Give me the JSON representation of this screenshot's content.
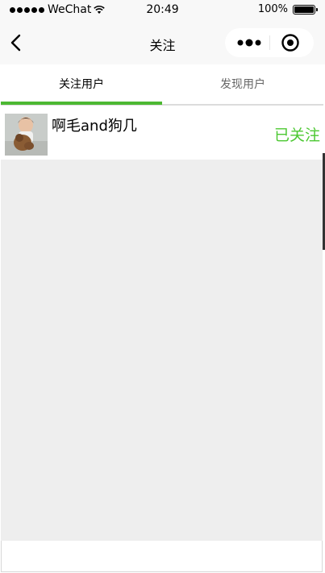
{
  "status_bar": {
    "carrier": "WeChat",
    "time": "20:49",
    "battery": "100%",
    "signal_icon": "signal-dots-icon",
    "wifi_icon": "wifi-icon",
    "battery_icon": "battery-icon"
  },
  "nav": {
    "title": "关注",
    "back_icon": "chevron-left-icon",
    "more_icon": "more-dots-icon",
    "record_icon": "record-target-icon"
  },
  "tabs": [
    {
      "label": "关注用户",
      "active": true
    },
    {
      "label": "发现用户",
      "active": false
    }
  ],
  "accent_color": "#4cb832",
  "users": [
    {
      "name": "啊毛and狗几",
      "follow_label": "已关注"
    }
  ]
}
